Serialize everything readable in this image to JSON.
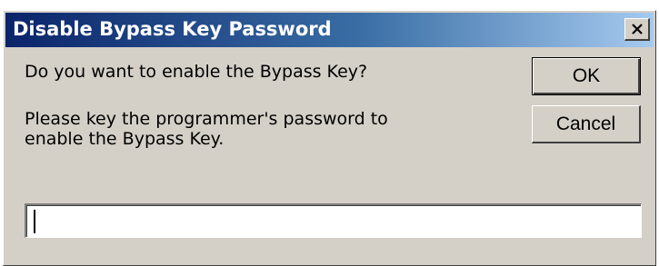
{
  "window": {
    "title": "Disable Bypass Key Password",
    "close_icon": "close-icon"
  },
  "message": {
    "question": "Do you want to enable the Bypass Key?",
    "instruction_line1": "Please key the programmer's password to",
    "instruction_line2": "enable the Bypass Key."
  },
  "buttons": {
    "ok_label": "OK",
    "cancel_label": "Cancel"
  },
  "password_field": {
    "value": "",
    "placeholder": ""
  },
  "colors": {
    "face": "#d4d0c8",
    "title_start": "#0a246a",
    "title_end": "#a6caf0"
  }
}
